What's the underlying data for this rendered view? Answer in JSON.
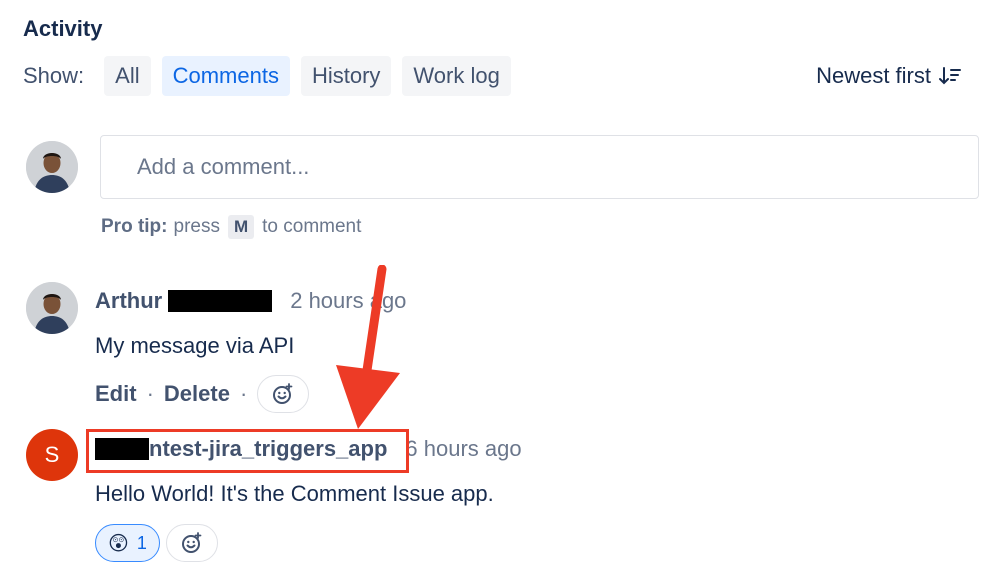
{
  "activity": {
    "title": "Activity",
    "show_label": "Show:",
    "filters": [
      {
        "label": "All",
        "active": false
      },
      {
        "label": "Comments",
        "active": true
      },
      {
        "label": "History",
        "active": false
      },
      {
        "label": "Work log",
        "active": false
      }
    ],
    "sort_label": "Newest first",
    "sort_icon": "sort-descending-icon"
  },
  "composer": {
    "placeholder": "Add a comment...",
    "pro_tip_label": "Pro tip:",
    "pro_tip_press": "press",
    "pro_tip_key": "M",
    "pro_tip_suffix": "to comment"
  },
  "comments": [
    {
      "author": "Arthur",
      "author_redacted": true,
      "timestamp": "2 hours ago",
      "body": "My message via API",
      "actions": [
        "Edit",
        "Delete"
      ],
      "avatar": "user-photo"
    },
    {
      "author": "ntest-jira_triggers_app",
      "author_redacted_prefix": true,
      "timestamp": "6 hours ago",
      "body": "Hello World! It's the Comment Issue app.",
      "avatar_letter": "S",
      "reactions": [
        {
          "emoji": "😲",
          "count": "1"
        }
      ]
    }
  ],
  "colors": {
    "accent": "#0c66e4",
    "annotation": "#ed3b26",
    "avatar_letter_bg": "#de350b"
  }
}
